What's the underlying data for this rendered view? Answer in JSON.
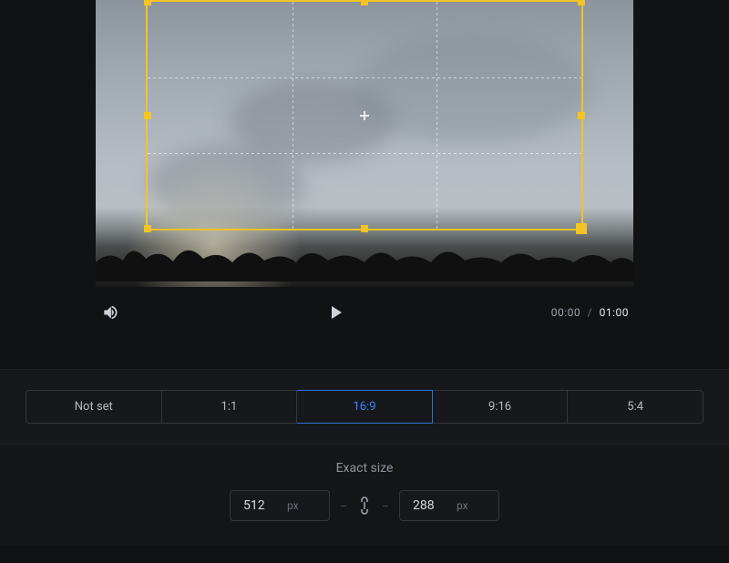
{
  "playback": {
    "current_time": "00:00",
    "total_time": "01:00",
    "separator": "/"
  },
  "aspect_ratios": {
    "options": [
      {
        "label": "Not set",
        "active": false
      },
      {
        "label": "1:1",
        "active": false
      },
      {
        "label": "16:9",
        "active": true
      },
      {
        "label": "9:16",
        "active": false
      },
      {
        "label": "5:4",
        "active": false
      }
    ]
  },
  "exact_size": {
    "title": "Exact size",
    "width": "512",
    "height": "288",
    "unit": "px",
    "locked": true
  },
  "colors": {
    "accent": "#3a84ff",
    "crop_handle": "#f3c423"
  }
}
